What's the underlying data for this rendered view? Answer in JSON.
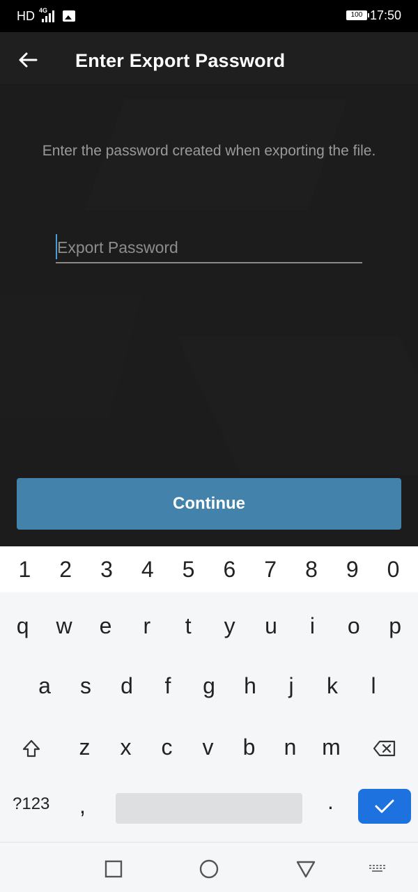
{
  "status_bar": {
    "network_label": "HD",
    "signal_type": "4G",
    "battery_level": "100",
    "time": "17:50",
    "icons": [
      "signal-icon",
      "image-notification-icon",
      "battery-icon"
    ]
  },
  "app_bar": {
    "title": "Enter Export Password",
    "back_icon": "arrow-left-icon"
  },
  "main": {
    "instruction": "Enter the password created when exporting the file.",
    "password_placeholder": "Export Password",
    "password_value": "",
    "continue_label": "Continue",
    "accent_color": "#4282AB"
  },
  "keyboard": {
    "number_row": [
      "1",
      "2",
      "3",
      "4",
      "5",
      "6",
      "7",
      "8",
      "9",
      "0"
    ],
    "row1": [
      "q",
      "w",
      "e",
      "r",
      "t",
      "y",
      "u",
      "i",
      "o",
      "p"
    ],
    "row2": [
      "a",
      "s",
      "d",
      "f",
      "g",
      "h",
      "j",
      "k",
      "l"
    ],
    "row3": [
      "z",
      "x",
      "c",
      "v",
      "b",
      "n",
      "m"
    ],
    "symbols_label": "?123",
    "comma": ",",
    "period": ".",
    "enter_color": "#1E72E0",
    "icons": [
      "shift-icon",
      "backspace-icon",
      "checkmark-icon"
    ]
  },
  "nav_bar": {
    "icons": [
      "recents-square-icon",
      "home-circle-icon",
      "back-triangle-icon",
      "keyboard-hide-icon"
    ]
  }
}
